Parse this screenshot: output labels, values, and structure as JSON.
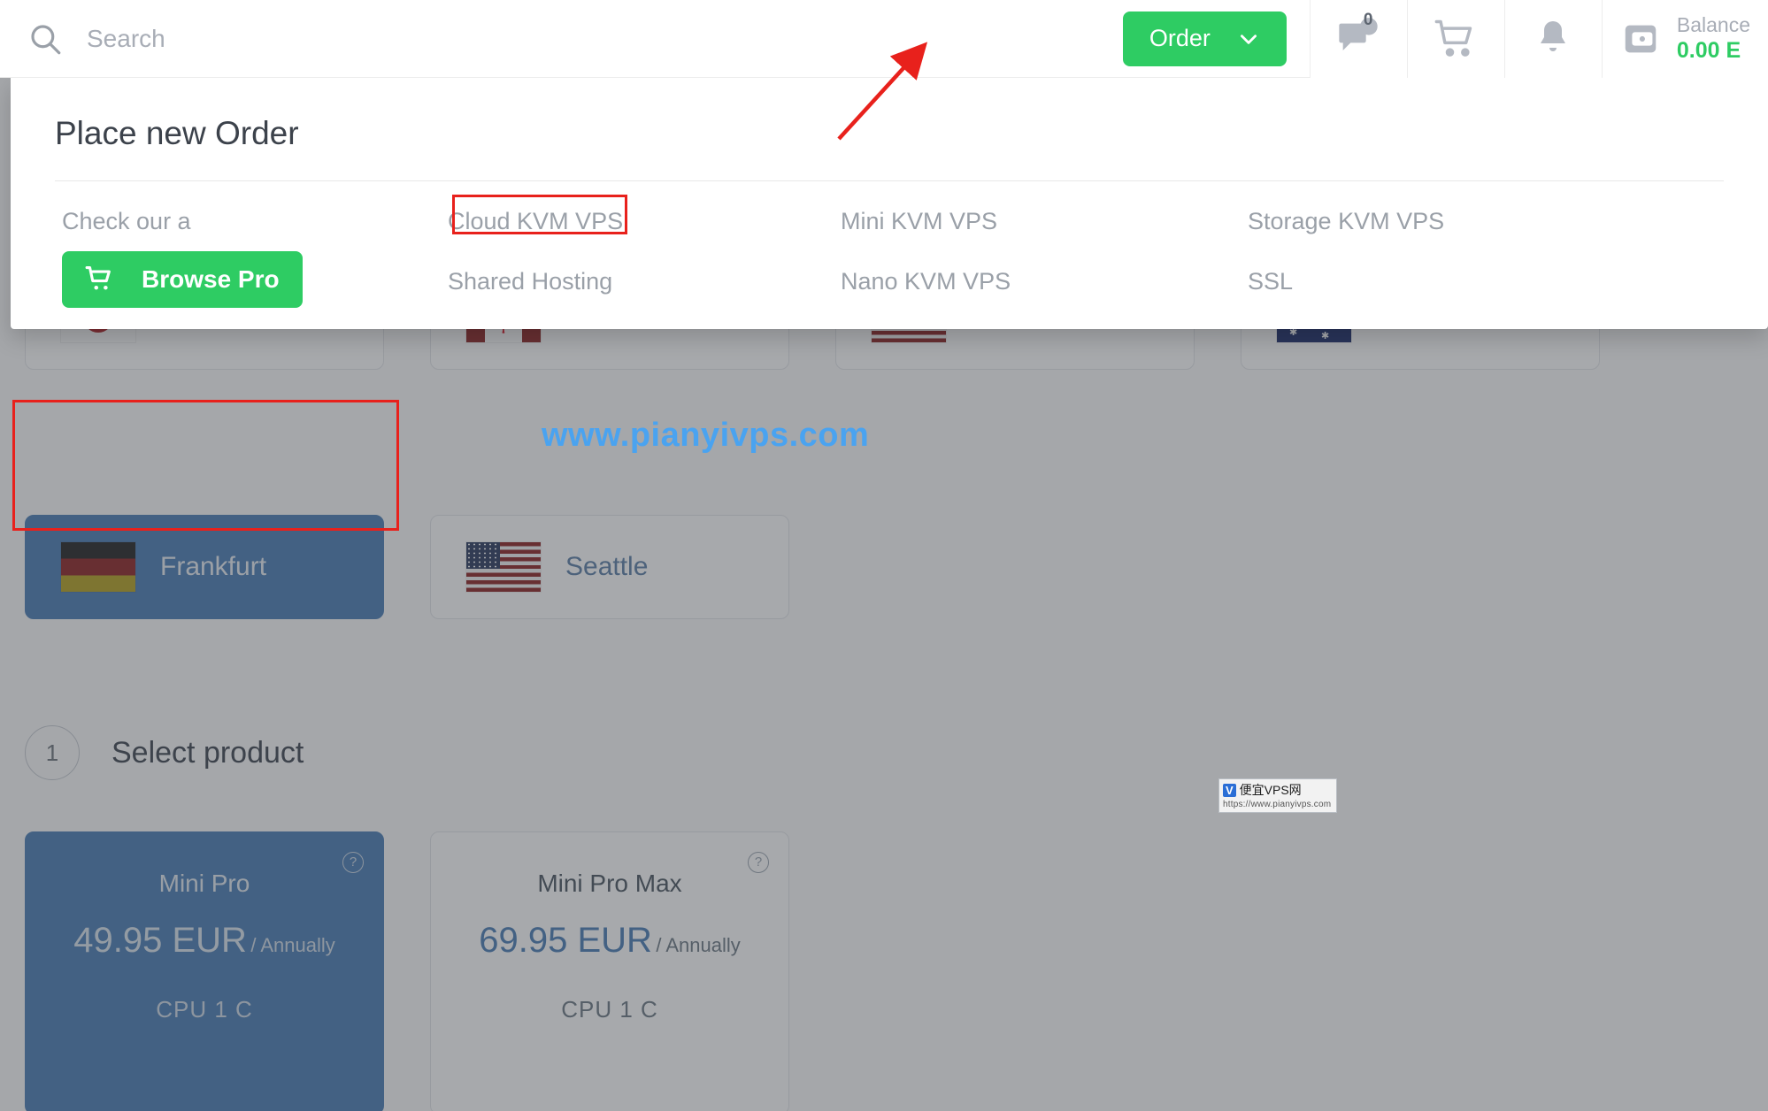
{
  "header": {
    "search": {
      "placeholder": "Search",
      "value": ""
    },
    "order_button": {
      "label": "Order",
      "chevron": "chevron-down-icon",
      "color": "#2ecc63"
    },
    "icons": [
      {
        "name": "support-ticket-icon",
        "badge": "0"
      },
      {
        "name": "cart-icon",
        "badge": ""
      },
      {
        "name": "bell-icon",
        "badge": ""
      }
    ],
    "balance": {
      "label": "Balance",
      "value": "0.00 E",
      "color": "#2ecc63",
      "icon": "wallet-icon"
    }
  },
  "dropdown": {
    "title": "Place new Order",
    "links": [
      "Cloud KVM VPS",
      "Mini KVM VPS",
      "Storage KVM VPS",
      "Shared Hosting",
      "Nano KVM VPS",
      "SSL"
    ],
    "promo_text": "Check our a",
    "browse_button": {
      "label": "Browse Pro",
      "icon": "cart-icon"
    }
  },
  "locations_top": [
    {
      "city": "",
      "flag": "jp"
    },
    {
      "city": "",
      "flag": "ca"
    },
    {
      "city": "",
      "flag": "us"
    },
    {
      "city": "",
      "flag": "au"
    }
  ],
  "locations": [
    {
      "city": "Frankfurt",
      "flag": "de",
      "selected": true
    },
    {
      "city": "Seattle",
      "flag": "us",
      "selected": false
    }
  ],
  "step": {
    "number": "1",
    "title": "Select product"
  },
  "products": [
    {
      "name": "Mini Pro",
      "price": "49.95 EUR",
      "cycle": "/ Annually",
      "spec": "CPU  1 C",
      "selected": true,
      "help": "?"
    },
    {
      "name": "Mini Pro Max",
      "price": "69.95 EUR",
      "cycle": "/ Annually",
      "spec": "CPU  1 C",
      "selected": false,
      "help": "?"
    }
  ],
  "watermark": {
    "main": "www.pianyivps.com",
    "badge_v": "V",
    "badge_text": "便宜VPS网",
    "badge_url": "https://www.pianyivps.com"
  },
  "annotations": {
    "color": "#e8211c",
    "boxes": [
      "mini-kvm-vps-link",
      "frankfurt-location-card"
    ],
    "arrow_target": "order-button"
  }
}
